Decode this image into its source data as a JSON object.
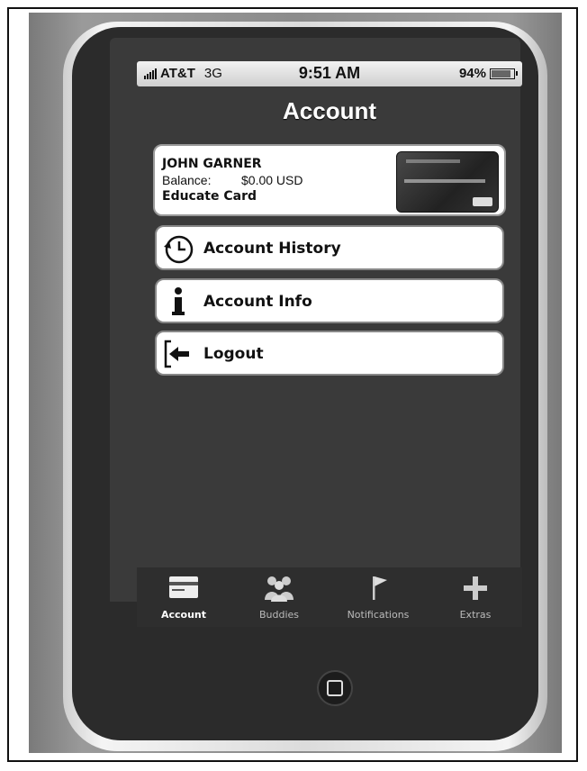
{
  "status_bar": {
    "carrier": "AT&T",
    "network": "3G",
    "time": "9:51 AM",
    "battery": "94%",
    "battery_level": 0.94
  },
  "header": {
    "title": "Account"
  },
  "card": {
    "name": "JOHN GARNER",
    "balance_label": "Balance:",
    "balance_value": "$0.00 USD",
    "card_type": "Educate Card"
  },
  "menu": {
    "items": [
      {
        "label": "Account History",
        "icon": "clock-history-icon"
      },
      {
        "label": "Account Info",
        "icon": "info-icon"
      },
      {
        "label": "Logout",
        "icon": "logout-arrow-icon"
      }
    ]
  },
  "tabbar": {
    "tabs": [
      {
        "label": "Account",
        "icon": "card-icon",
        "active": true
      },
      {
        "label": "Buddies",
        "icon": "people-icon",
        "active": false
      },
      {
        "label": "Notifications",
        "icon": "flag-icon",
        "active": false
      },
      {
        "label": "Extras",
        "icon": "plus-icon",
        "active": false
      }
    ]
  }
}
